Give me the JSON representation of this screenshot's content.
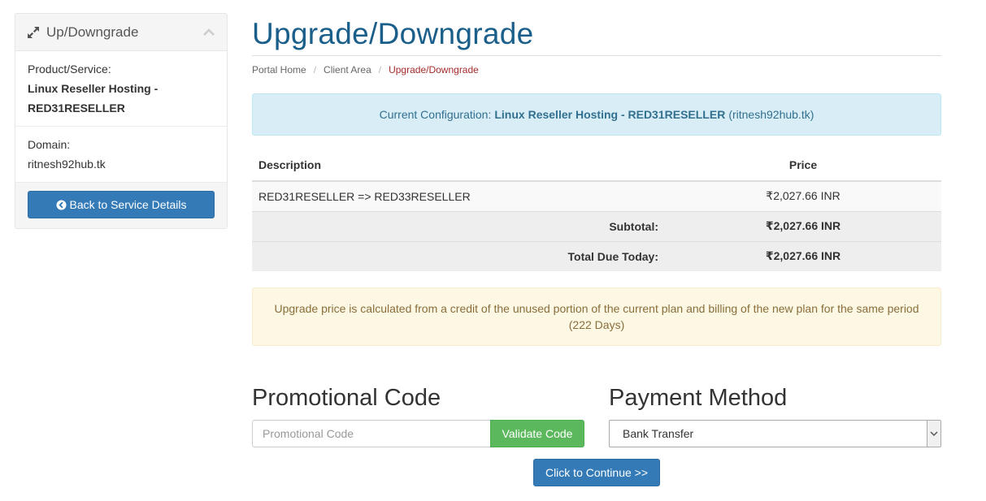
{
  "sidebar": {
    "header_title": "Up/Downgrade",
    "product_label": "Product/Service:",
    "product_value": "Linux Reseller Hosting - RED31RESELLER",
    "domain_label": "Domain:",
    "domain_value": "ritnesh92hub.tk",
    "back_button": "Back to Service Details"
  },
  "page": {
    "title": "Upgrade/Downgrade",
    "breadcrumb": [
      "Portal Home",
      "Client Area",
      "Upgrade/Downgrade"
    ]
  },
  "current_config": {
    "prefix": "Current Configuration:",
    "product": "Linux Reseller Hosting - RED31RESELLER",
    "domain": "(ritnesh92hub.tk)"
  },
  "summary_table": {
    "headers": [
      "Description",
      "Price"
    ],
    "item": {
      "description": "RED31RESELLER => RED33RESELLER",
      "price": "₹2,027.66 INR"
    },
    "subtotal": {
      "label": "Subtotal:",
      "value": "₹2,027.66 INR"
    },
    "total": {
      "label": "Total Due Today:",
      "value": "₹2,027.66 INR"
    }
  },
  "notice": "Upgrade price is calculated from a credit of the unused portion of the current plan and billing of the new plan for the same period (222 Days)",
  "promo": {
    "title": "Promotional Code",
    "placeholder": "Promotional Code",
    "validate_button": "Validate Code"
  },
  "payment": {
    "title": "Payment Method",
    "selected": "Bank Transfer"
  },
  "continue_button": "Click to Continue >>",
  "colors": {
    "primary": "#337ab7",
    "success": "#5cb85c",
    "title": "#1a5e8a",
    "breadcrumb_active": "#a52a2a"
  }
}
